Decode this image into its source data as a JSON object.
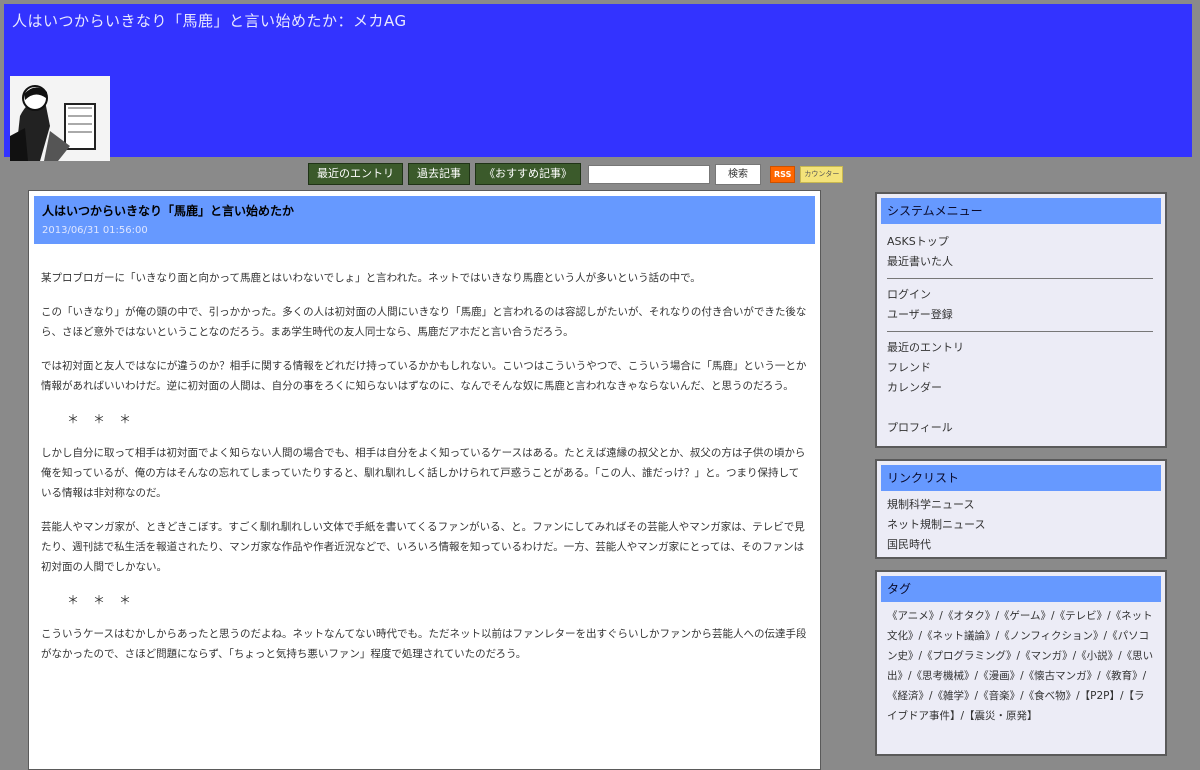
{
  "header": {
    "title": "人はいつからいきなり「馬鹿」と言い始めたか：メカAG",
    "bg_color": "#3333ff"
  },
  "nav": {
    "items": [
      "最近のエントリ",
      "過去記事",
      "《おすすめ記事》"
    ],
    "search_button": "検索",
    "rss_badge": "RSS",
    "counter_badge": "カウンター"
  },
  "post": {
    "title": "人はいつからいきなり「馬鹿」と言い始めたか",
    "date": "2013/06/31 01:56:00",
    "paragraphs": [
      "某プロブロガーに「いきなり面と向かって馬鹿とはいわないでしょ」と言われた。ネットではいきなり馬鹿という人が多いという話の中で。",
      "この「いきなり」が俺の頭の中で、引っかかった。多くの人は初対面の人間にいきなり「馬鹿」と言われるのは容認しがたいが、それなりの付き合いができた後なら、さほど意外ではないということなのだろう。まあ学生時代の友人同士なら、馬鹿だアホだと言い合うだろう。",
      "では初対面と友人ではなにが違うのか？相手に関する情報をどれだけ持っているかかもしれない。こいつはこういうやつで、こういう場合に「馬鹿」という一とか情報があればいいわけだ。逆に初対面の人間は、自分の事をろくに知らないはずなのに、なんでそんな奴に馬鹿と言われなきゃならないんだ、と思うのだろう。",
      "しかし自分に取って相手は初対面でよく知らない人間の場合でも、相手は自分をよく知っているケースはある。たとえば遠縁の叔父とか、叔父の方は子供の頃から俺を知っているが、俺の方はそんなの忘れてしまっていたりすると、馴れ馴れしく話しかけられて戸惑うことがある。「この人、誰だっけ？」と。つまり保持している情報は非対称なのだ。",
      "芸能人やマンガ家が、ときどきこぼす。すごく馴れ馴れしい文体で手紙を書いてくるファンがいる、と。ファンにしてみればその芸能人やマンガ家は、テレビで見たり、週刊誌で私生活を報道されたり、マンガ家な作品や作者近況などで、いろいろ情報を知っているわけだ。一方、芸能人やマンガ家にとっては、そのファンは初対面の人間でしかない。",
      "こういうケースはむかしからあったと思うのだよね。ネットなんてない時代でも。ただネット以前はファンレターを出すぐらいしかファンから芸能人への伝達手段がなかったので、さほど問題にならず、「ちょっと気持ち悪いファン」程度で処理されていたのだろう。"
    ],
    "separator": "＊＊＊"
  },
  "system_menu": {
    "title": "システムメニュー",
    "group1": [
      "ASKSトップ",
      "最近書いた人"
    ],
    "group2": [
      "ログイン",
      "ユーザー登録"
    ],
    "group3": [
      "最近のエントリ",
      "フレンド",
      "カレンダー"
    ],
    "profile": "プロフィール"
  },
  "link_list": {
    "title": "リンクリスト",
    "items": [
      "規制科学ニュース",
      "ネット規制ニュース",
      "国民時代"
    ]
  },
  "tags": {
    "title": "タグ",
    "text": "《アニメ》/《オタク》/《ゲーム》/《テレビ》/《ネット文化》/《ネット議論》/《ノンフィクション》/《パソコン史》/《プログラミング》/《マンガ》/《小説》/《思い出》/《思考機械》/《漫画》/《懐古マンガ》/《教育》/《経済》/《雑学》/《音楽》/《食べ物》/【P2P】/【ライブドア事件】/【震災・原発】"
  }
}
